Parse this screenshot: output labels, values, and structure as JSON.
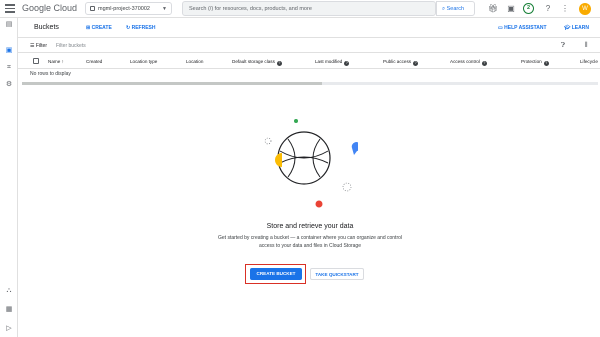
{
  "topbar": {
    "logo": "Google Cloud",
    "project": "mgml-project-370002",
    "search_placeholder": "Search (/) for resources, docs, products, and more",
    "search_button": "Search",
    "notifications_count": "2",
    "avatar_initial": "W"
  },
  "subbar": {
    "title": "Buckets",
    "create": "CREATE",
    "refresh": "REFRESH",
    "help_assistant": "HELP ASSISTANT",
    "learn": "LEARN"
  },
  "filter": {
    "label": "Filter",
    "placeholder": "Filter buckets"
  },
  "table": {
    "columns": [
      "Name",
      "Created",
      "Location type",
      "Location",
      "Default storage class",
      "Last modified",
      "Public access",
      "Access control",
      "Protection",
      "Lifecycle"
    ],
    "empty": "No rows to display"
  },
  "empty_state": {
    "title": "Store and retrieve your data",
    "description": "Get started by creating a bucket — a container where you can organize and control access to your data and files in Cloud Storage",
    "create_button": "CREATE BUCKET",
    "quickstart_button": "TAKE QUICKSTART"
  },
  "colors": {
    "accent": "#1a73e8",
    "highlight_border": "#d93025",
    "illus_yellow": "#fbbc04",
    "illus_blue": "#4285f4",
    "illus_red": "#ea4335",
    "illus_green": "#34a853"
  }
}
